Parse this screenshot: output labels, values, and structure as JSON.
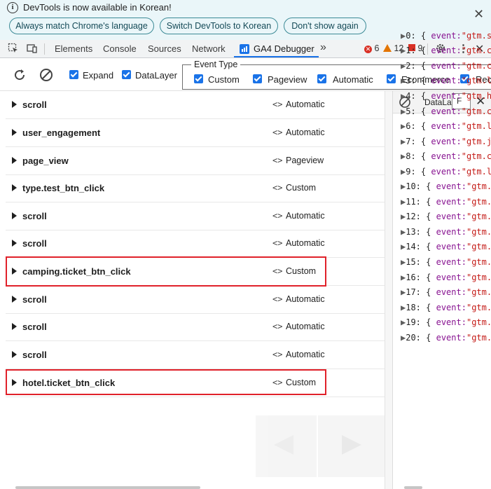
{
  "infobar": {
    "message": "DevTools is now available in Korean!",
    "buttons": [
      "Always match Chrome's language",
      "Switch DevTools to Korean",
      "Don't show again"
    ]
  },
  "tabs": [
    "Elements",
    "Console",
    "Sources",
    "Network",
    "GA4 Debugger"
  ],
  "active_tab": "GA4 Debugger",
  "counts": {
    "errors": "6",
    "warnings": "12",
    "issues": "9"
  },
  "toolbar": {
    "expand_label": "Expand",
    "datalayer_label": "DataLayer",
    "event_type_legend": "Event Type",
    "event_types": [
      "Custom",
      "Pageview",
      "Automatic",
      "Ecommerce",
      "Reco"
    ]
  },
  "events": [
    {
      "name": "scroll",
      "code": "<>",
      "type": "Automatic"
    },
    {
      "name": "user_engagement",
      "code": "<>",
      "type": "Automatic"
    },
    {
      "name": "page_view",
      "code": "<>",
      "type": "Pageview"
    },
    {
      "name": "type.test_btn_click",
      "code": "<>",
      "type": "Custom"
    },
    {
      "name": "scroll",
      "code": "<>",
      "type": "Automatic"
    },
    {
      "name": "scroll",
      "code": "<>",
      "type": "Automatic"
    },
    {
      "name": "camping.ticket_btn_click",
      "code": "<>",
      "type": "Custom"
    },
    {
      "name": "scroll",
      "code": "<>",
      "type": "Automatic"
    },
    {
      "name": "scroll",
      "code": "<>",
      "type": "Automatic"
    },
    {
      "name": "scroll",
      "code": "<>",
      "type": "Automatic"
    },
    {
      "name": "hotel.ticket_btn_click",
      "code": "<>",
      "type": "Custom"
    }
  ],
  "right_panel": {
    "title": "DataLay",
    "filter_value": "F",
    "datalayer": [
      {
        "idx": "0:",
        "key": "event:",
        "val": "\"gtm.s"
      },
      {
        "idx": "1:",
        "key": "event:",
        "val": "\"gtm.c"
      },
      {
        "idx": "2:",
        "key": "event:",
        "val": "\"gtm.c"
      },
      {
        "idx": "3:",
        "key": "event:",
        "val": "\"gtm.l"
      },
      {
        "idx": "4:",
        "key": "event:",
        "val": "\"gtm.h"
      },
      {
        "idx": "5:",
        "key": "event:",
        "val": "\"gtm.c"
      },
      {
        "idx": "6:",
        "key": "event:",
        "val": "\"gtm.l"
      },
      {
        "idx": "7:",
        "key": "event:",
        "val": "\"gtm.j"
      },
      {
        "idx": "8:",
        "key": "event:",
        "val": "\"gtm.c"
      },
      {
        "idx": "9:",
        "key": "event:",
        "val": "\"gtm.l"
      },
      {
        "idx": "10:",
        "key": "event:",
        "val": "\"gtm."
      },
      {
        "idx": "11:",
        "key": "event:",
        "val": "\"gtm."
      },
      {
        "idx": "12:",
        "key": "event:",
        "val": "\"gtm."
      },
      {
        "idx": "13:",
        "key": "event:",
        "val": "\"gtm."
      },
      {
        "idx": "14:",
        "key": "event:",
        "val": "\"gtm."
      },
      {
        "idx": "15:",
        "key": "event:",
        "val": "\"gtm."
      },
      {
        "idx": "16:",
        "key": "event:",
        "val": "\"gtm."
      },
      {
        "idx": "17:",
        "key": "event:",
        "val": "\"gtm."
      },
      {
        "idx": "18:",
        "key": "event:",
        "val": "\"gtm."
      },
      {
        "idx": "19:",
        "key": "event:",
        "val": "\"gtm."
      },
      {
        "idx": "20:",
        "key": "event:",
        "val": "\"gtm."
      }
    ]
  },
  "colors": {
    "highlight": "#e0212a",
    "accent": "#1a73e8",
    "infobar_bg": "#eaf6f9"
  }
}
